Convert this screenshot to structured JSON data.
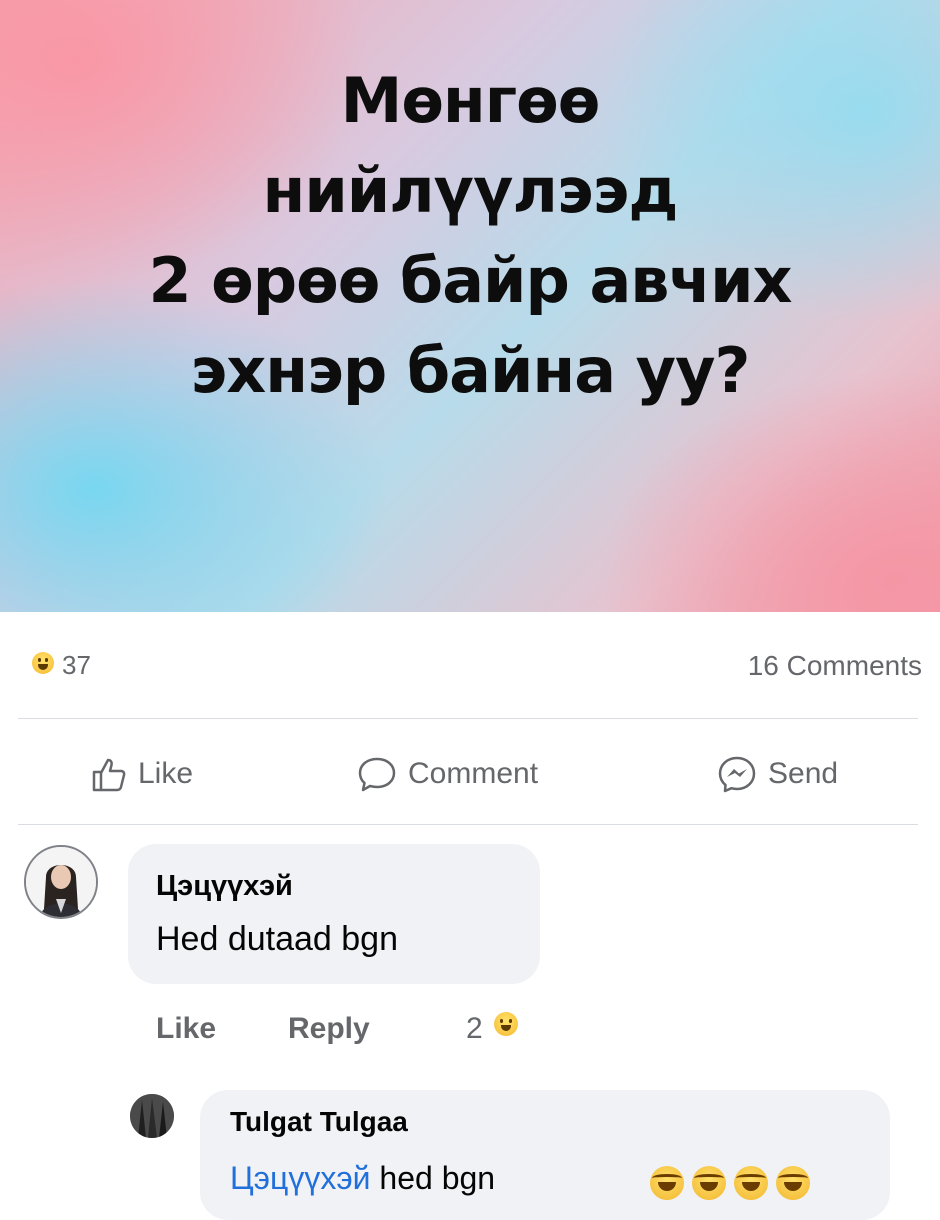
{
  "post": {
    "banner_lines": [
      "Мөнгөө",
      "нийлүүлээд",
      "2 өрөө байр авчих",
      "эхнэр байна уу?"
    ],
    "reaction_count": "37",
    "comments_count": "16 Comments"
  },
  "actions": {
    "like": "Like",
    "comment": "Comment",
    "send": "Send"
  },
  "comments": [
    {
      "author": "Цэцүүхэй",
      "text": "Hed dutaad bgn",
      "like_label": "Like",
      "reply_label": "Reply",
      "reaction_count": "2"
    },
    {
      "author": "Tulgat Tulgaa",
      "mention": "Цэцүүхэй",
      "text": " hed bgn"
    }
  ],
  "icons": [
    "haha-reaction-icon",
    "like-thumb-icon",
    "comment-bubble-icon",
    "messenger-send-icon",
    "laughing-emoji-icon"
  ],
  "colors": {
    "text": "#050505",
    "secondary": "#65676b",
    "bubble": "#f0f2f5",
    "mention": "#216fdb"
  }
}
